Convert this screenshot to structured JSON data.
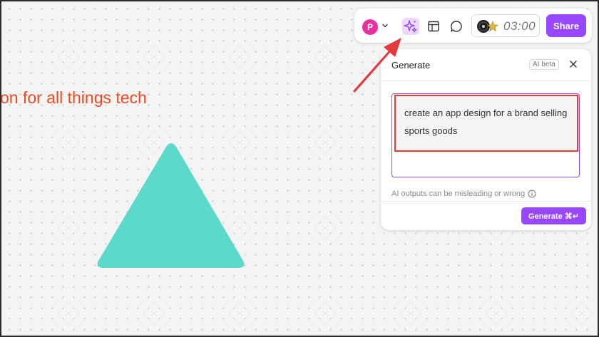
{
  "canvas": {
    "heading": "on for all things tech",
    "heading_color": "#ee4a22",
    "triangle_color": "#5dd9cc"
  },
  "toolbar": {
    "avatar_initial": "P",
    "avatar_color": "#ea2fa3",
    "icons": [
      "chevron-down-icon",
      "ai-sparkle-icon",
      "layout-icon",
      "comment-icon",
      "timer-music-icon",
      "star-icon"
    ],
    "timer": "03:00",
    "share_label": "Share",
    "accent": "#9747ff"
  },
  "generate_panel": {
    "title": "Generate",
    "badge": "AI beta",
    "prompt": "create an app design for a brand selling sports goods",
    "disclaimer": "AI outputs can be misleading or wrong",
    "generate_label": "Generate ⌘↵"
  },
  "annotation": {
    "color": "#e33b3b"
  }
}
